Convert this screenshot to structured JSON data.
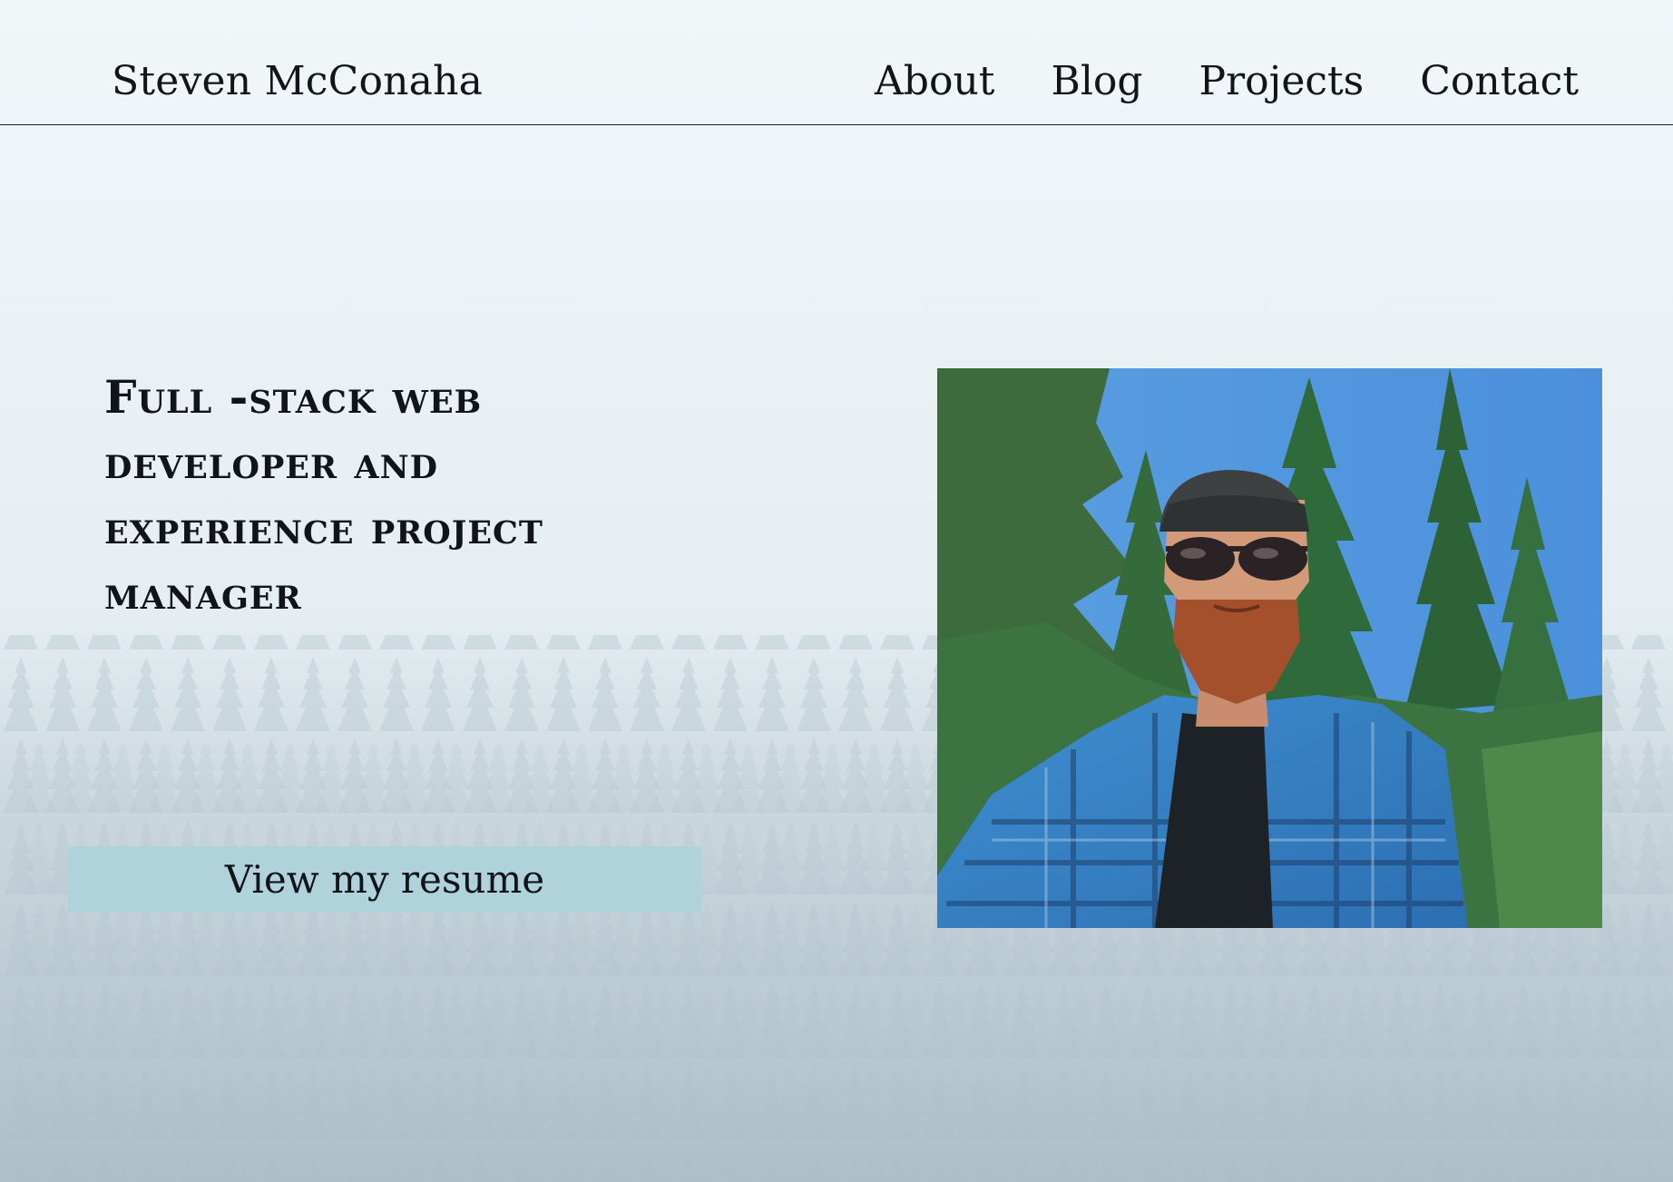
{
  "header": {
    "site_title": "Steven McConaha",
    "nav": [
      {
        "label": "About"
      },
      {
        "label": "Blog"
      },
      {
        "label": "Projects"
      },
      {
        "label": "Contact"
      }
    ]
  },
  "hero": {
    "headline": "Full -stack web developer and experience project manager",
    "resume_button": "View my resume"
  },
  "colors": {
    "button_bg": "#b0d2da",
    "text": "#111418",
    "background": "#e7eef2"
  }
}
